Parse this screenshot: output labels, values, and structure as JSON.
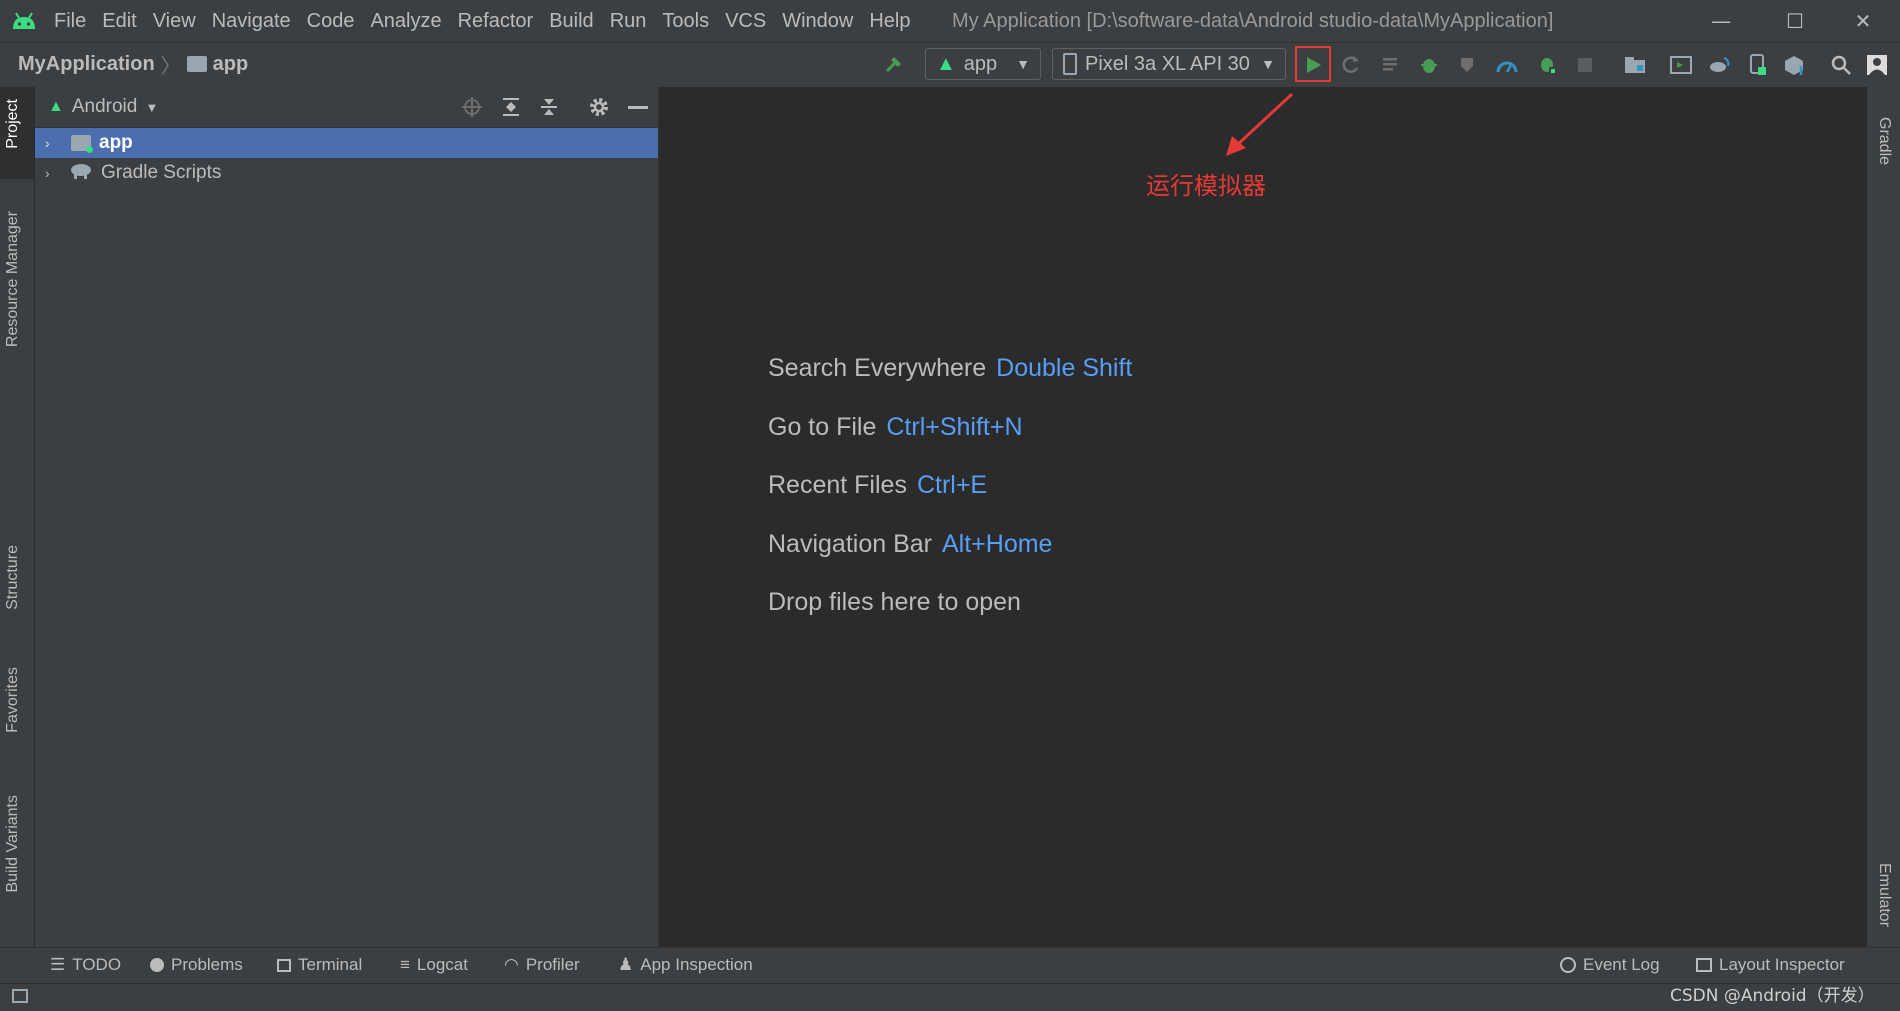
{
  "menu": [
    "File",
    "Edit",
    "View",
    "Navigate",
    "Code",
    "Analyze",
    "Refactor",
    "Build",
    "Run",
    "Tools",
    "VCS",
    "Window",
    "Help"
  ],
  "window_title": "My Application [D:\\software-data\\Android studio-data\\MyApplication]",
  "breadcrumb": {
    "project": "MyApplication",
    "module": "app"
  },
  "toolbar": {
    "run_config": "app",
    "device": "Pixel 3a XL API 30"
  },
  "annotation": "运行模拟器",
  "left_tabs": [
    "Project",
    "Resource Manager",
    "Structure",
    "Favorites",
    "Build Variants"
  ],
  "right_tabs": [
    "Gradle",
    "Emulator"
  ],
  "project_panel": {
    "view_mode": "Android",
    "tree": [
      {
        "label": "app",
        "selected": true
      },
      {
        "label": "Gradle Scripts",
        "selected": false
      }
    ]
  },
  "editor_hints": [
    {
      "label": "Search Everywhere",
      "key": "Double Shift"
    },
    {
      "label": "Go to File",
      "key": "Ctrl+Shift+N"
    },
    {
      "label": "Recent Files",
      "key": "Ctrl+E"
    },
    {
      "label": "Navigation Bar",
      "key": "Alt+Home"
    },
    {
      "label": "Drop files here to open",
      "key": ""
    }
  ],
  "bottom_tools": [
    "TODO",
    "Problems",
    "Terminal",
    "Logcat",
    "Profiler",
    "App Inspection"
  ],
  "bottom_right_tools": [
    "Event Log",
    "Layout Inspector"
  ],
  "watermark": "CSDN @Android（开发）",
  "colors": {
    "accent_green": "#499c54",
    "annotation_red": "#e53935",
    "selection": "#4b6eaf",
    "link_blue": "#589df6"
  }
}
